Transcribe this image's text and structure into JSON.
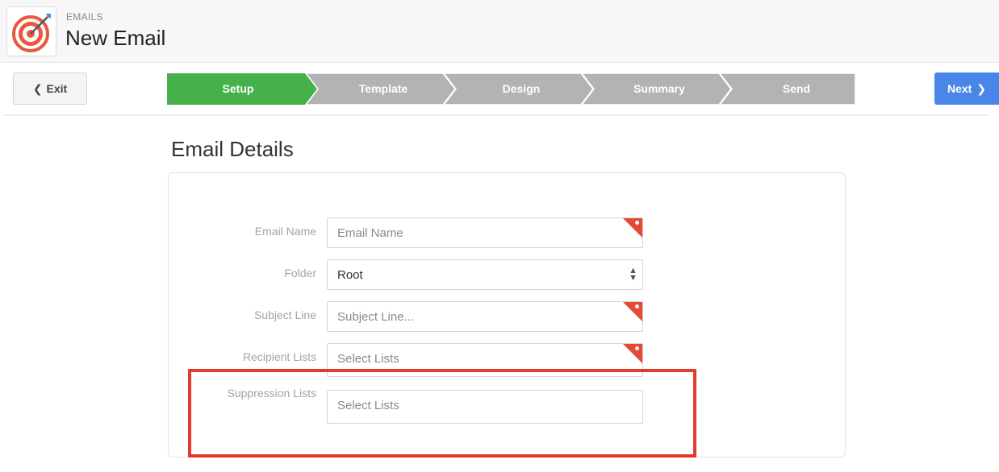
{
  "header": {
    "section_label": "EMAILS",
    "title": "New Email"
  },
  "toolbar": {
    "exit_label": "Exit",
    "next_label": "Next",
    "steps": [
      {
        "label": "Setup",
        "active": true
      },
      {
        "label": "Template",
        "active": false
      },
      {
        "label": "Design",
        "active": false
      },
      {
        "label": "Summary",
        "active": false
      },
      {
        "label": "Send",
        "active": false
      }
    ]
  },
  "main": {
    "heading": "Email Details",
    "fields": [
      {
        "label": "Email Name",
        "value": "",
        "placeholder": "Email Name",
        "required": true
      },
      {
        "label": "Folder",
        "value": "Root",
        "type": "select",
        "required": false
      },
      {
        "label": "Subject Line",
        "value": "",
        "placeholder": "Subject Line...",
        "required": true
      },
      {
        "label": "Recipient Lists",
        "value": "",
        "placeholder": "Select Lists",
        "required": true
      },
      {
        "label": "Suppression Lists",
        "value": "",
        "placeholder": "Select Lists",
        "required": false
      }
    ]
  },
  "colors": {
    "active_step": "#46b04a",
    "inactive_step": "#b3b3b3",
    "next_button": "#4a86e8",
    "required_marker": "#e24a33",
    "highlight": "#e23a2d"
  },
  "icons": {
    "logo": "target-arrow-icon",
    "exit": "chevron-left-icon",
    "next": "chevron-right-icon",
    "folder_select": "up-down-spinner-icon"
  }
}
